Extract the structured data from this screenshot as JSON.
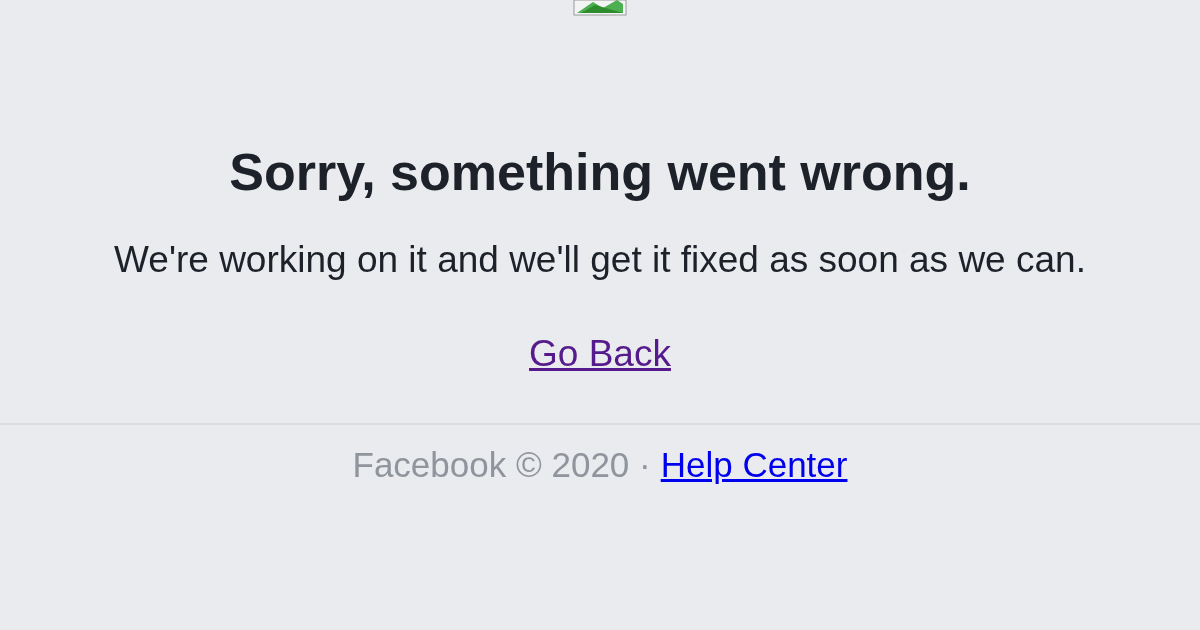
{
  "heading": "Sorry, something went wrong.",
  "message": "We're working on it and we'll get it fixed as soon as we can.",
  "back_link": {
    "label": "Go Back",
    "visited": true
  },
  "footer": {
    "copyright": "Facebook © 2020 ·",
    "help_link": "Help Center"
  }
}
